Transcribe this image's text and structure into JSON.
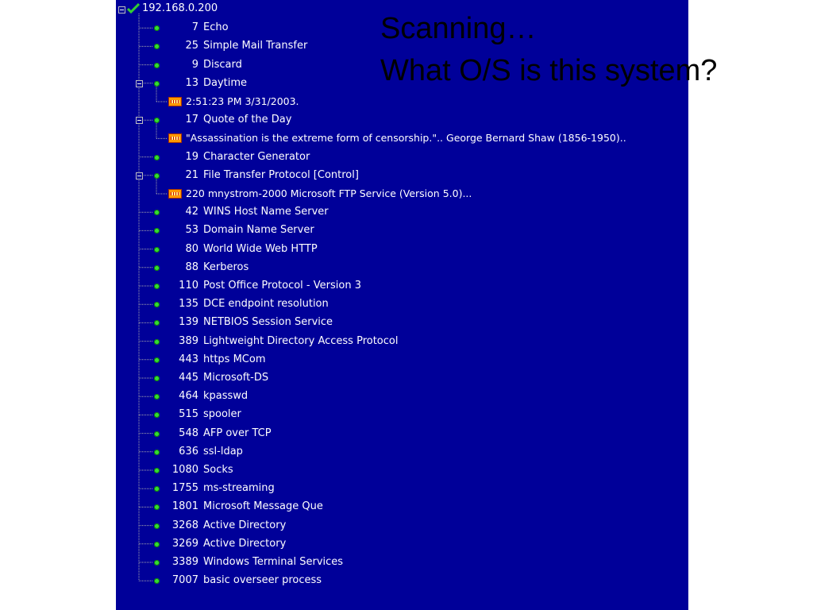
{
  "root": {
    "label": "192.168.0.200",
    "icon": "check-icon"
  },
  "overlay": {
    "line1": "Scanning…",
    "line2": "What O/S is this system?"
  },
  "colors": {
    "panel_bg": "#000099",
    "text": "#ffffff",
    "port_dot": "#33dd33",
    "banner_icon": "#ff9900",
    "check": "#33cc33"
  },
  "ports": [
    {
      "port": "7",
      "service": "Echo"
    },
    {
      "port": "25",
      "service": "Simple Mail Transfer"
    },
    {
      "port": "9",
      "service": "Discard"
    },
    {
      "port": "13",
      "service": "Daytime",
      "detail": "2:51:23 PM 3/31/2003."
    },
    {
      "port": "17",
      "service": "Quote of the Day",
      "detail": "\"Assassination is the extreme form of censorship.\".. George Bernard Shaw (1856-1950).."
    },
    {
      "port": "19",
      "service": "Character Generator"
    },
    {
      "port": "21",
      "service": "File Transfer Protocol [Control]",
      "detail": "220 mnystrom-2000 Microsoft FTP Service (Version 5.0)..."
    },
    {
      "port": "42",
      "service": "WINS Host Name Server"
    },
    {
      "port": "53",
      "service": "Domain Name Server"
    },
    {
      "port": "80",
      "service": "World Wide Web HTTP"
    },
    {
      "port": "88",
      "service": "Kerberos"
    },
    {
      "port": "110",
      "service": "Post Office Protocol - Version 3"
    },
    {
      "port": "135",
      "service": "DCE endpoint resolution"
    },
    {
      "port": "139",
      "service": "NETBIOS Session Service"
    },
    {
      "port": "389",
      "service": "Lightweight Directory Access Protocol"
    },
    {
      "port": "443",
      "service": "https  MCom"
    },
    {
      "port": "445",
      "service": "Microsoft-DS"
    },
    {
      "port": "464",
      "service": "kpasswd"
    },
    {
      "port": "515",
      "service": "spooler"
    },
    {
      "port": "548",
      "service": "AFP over TCP"
    },
    {
      "port": "636",
      "service": "ssl-ldap"
    },
    {
      "port": "1080",
      "service": "Socks"
    },
    {
      "port": "1755",
      "service": "ms-streaming"
    },
    {
      "port": "1801",
      "service": "Microsoft Message Que"
    },
    {
      "port": "3268",
      "service": "Active Directory"
    },
    {
      "port": "3269",
      "service": "Active Directory"
    },
    {
      "port": "3389",
      "service": "Windows Terminal Services"
    },
    {
      "port": "7007",
      "service": "basic overseer process"
    }
  ]
}
